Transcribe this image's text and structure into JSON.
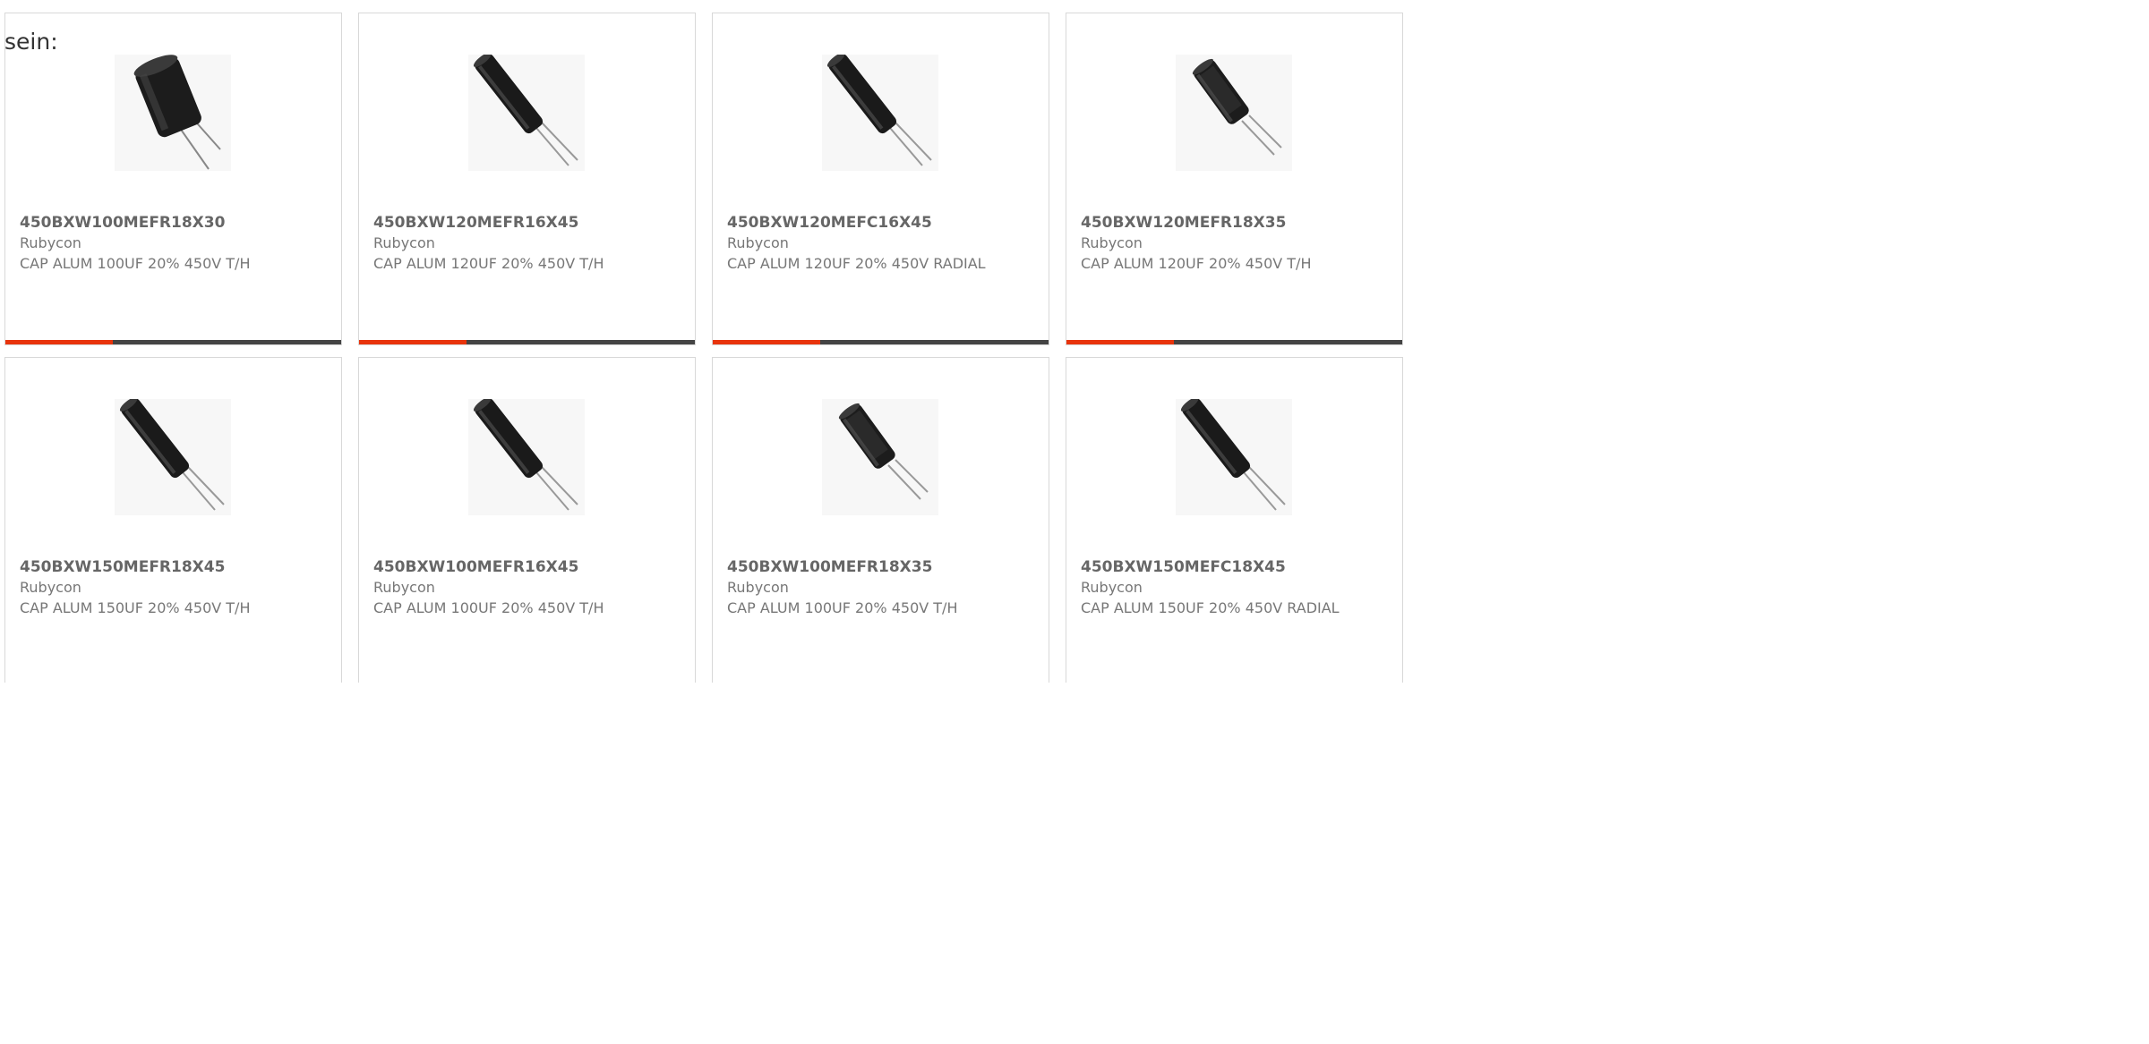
{
  "intro_text": "sein:",
  "accent_color": "#e8340c",
  "products": [
    {
      "part": "450BXW100MEFR18X30",
      "manufacturer": "Rubycon",
      "description": "CAP ALUM 100UF 20% 450V T/H",
      "image": "capacitor-short-thick"
    },
    {
      "part": "450BXW120MEFR16X45",
      "manufacturer": "Rubycon",
      "description": "CAP ALUM 120UF 20% 450V T/H",
      "image": "capacitor-long"
    },
    {
      "part": "450BXW120MEFC16X45",
      "manufacturer": "Rubycon",
      "description": "CAP ALUM 120UF 20% 450V RADIAL",
      "image": "capacitor-long"
    },
    {
      "part": "450BXW120MEFR18X35",
      "manufacturer": "Rubycon",
      "description": "CAP ALUM 120UF 20% 450V T/H",
      "image": "capacitor-medium"
    },
    {
      "part": "450BXW150MEFR18X45",
      "manufacturer": "Rubycon",
      "description": "CAP ALUM 150UF 20% 450V T/H",
      "image": "capacitor-long"
    },
    {
      "part": "450BXW100MEFR16X45",
      "manufacturer": "Rubycon",
      "description": "CAP ALUM 100UF 20% 450V T/H",
      "image": "capacitor-long"
    },
    {
      "part": "450BXW100MEFR18X35",
      "manufacturer": "Rubycon",
      "description": "CAP ALUM 100UF 20% 450V T/H",
      "image": "capacitor-medium"
    },
    {
      "part": "450BXW150MEFC18X45",
      "manufacturer": "Rubycon",
      "description": "CAP ALUM 150UF 20% 450V RADIAL",
      "image": "capacitor-long"
    }
  ]
}
